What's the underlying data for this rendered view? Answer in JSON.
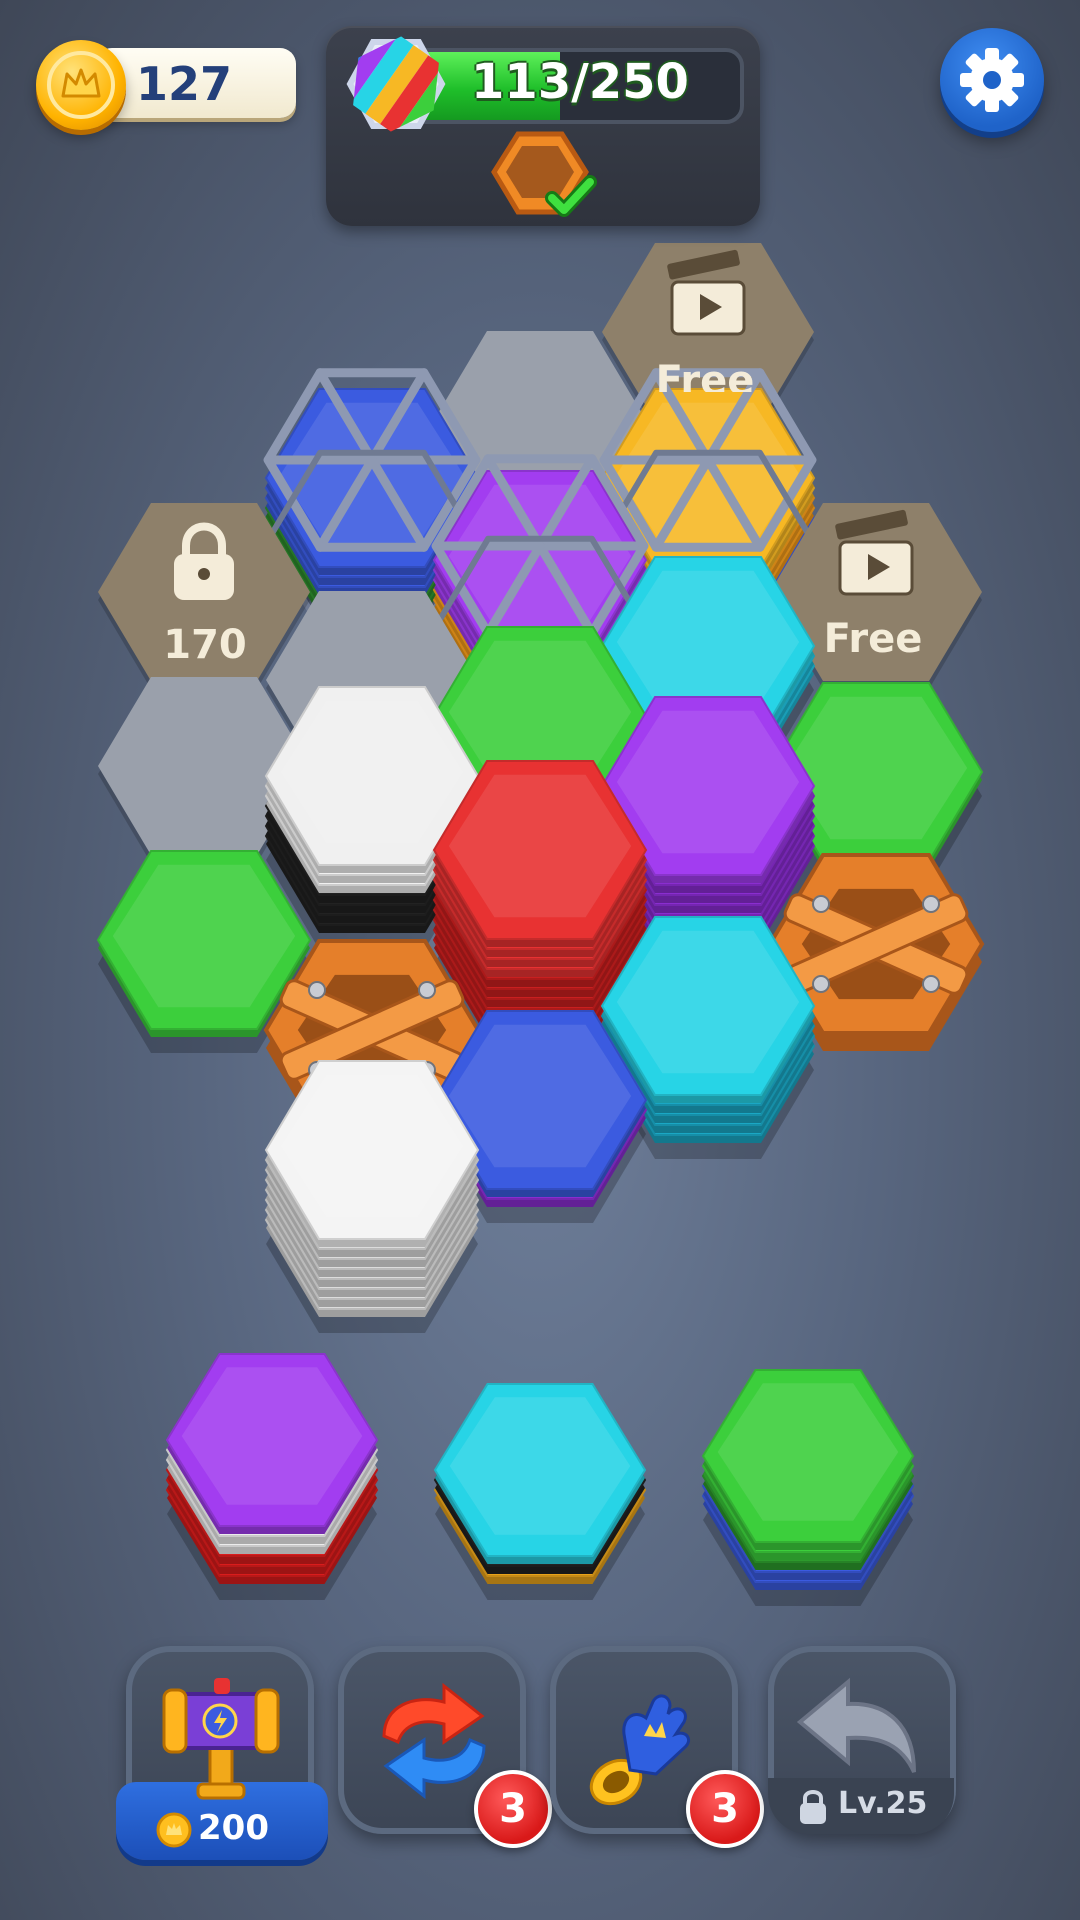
{
  "hud": {
    "coins": "127",
    "progress": {
      "text": "113/250",
      "current": 113,
      "total": 250
    },
    "next_reward_icon": "wooden-crate-hex-check-icon",
    "settings_icon": "gear-icon"
  },
  "locked_tiles": [
    {
      "type": "free-video",
      "label": "Free",
      "icon": "clapperboard-icon"
    },
    {
      "type": "free-video",
      "label": "Free",
      "icon": "clapperboard-icon"
    },
    {
      "type": "locked",
      "label": "170",
      "icon": "padlock-icon"
    }
  ],
  "board_stacks": [
    {
      "position": "top-left-caged",
      "layers": [
        "#2d8a2d",
        "#2d8a2d",
        "#3b5be0",
        "#3b5be0",
        "#3b5be0"
      ],
      "caged": true
    },
    {
      "position": "top-right-caged",
      "layers": [
        "#3b5be0",
        "#f29a1a",
        "#f29a1a",
        "#f7b824",
        "#f7b824"
      ],
      "caged": true
    },
    {
      "position": "center-caged",
      "layers": [
        "#f29a1a",
        "#f29a1a",
        "#a23df0",
        "#a23df0",
        "#a23df0"
      ],
      "caged": true
    },
    {
      "position": "cyan-upper",
      "layers": [
        "#1fb9d6",
        "#1fb9d6",
        "#27d4e6"
      ]
    },
    {
      "position": "green-center",
      "layers": [
        "#3ccf3c"
      ]
    },
    {
      "position": "green-right",
      "layers": [
        "#3ccf3c"
      ]
    },
    {
      "position": "white-black",
      "layers": [
        "#222",
        "#222",
        "#222",
        "#222",
        "#f0f0f0",
        "#f0f0f0",
        "#f0f0f0"
      ]
    },
    {
      "position": "red-tall",
      "layers": [
        "#c91f1f",
        "#c91f1f",
        "#c91f1f",
        "#c91f1f",
        "#c91f1f",
        "#c91f1f",
        "#e83232",
        "#e83232",
        "#e83232",
        "#e83232"
      ]
    },
    {
      "position": "purple-tall",
      "layers": [
        "#8a2dd0",
        "#8a2dd0",
        "#8a2dd0",
        "#8a2dd0",
        "#8a2dd0",
        "#8a2dd0",
        "#a23df0"
      ]
    },
    {
      "position": "green-left",
      "layers": [
        "#3ccf3c"
      ]
    },
    {
      "position": "cyan-lower",
      "layers": [
        "#1aa7c4",
        "#1aa7c4",
        "#1aa7c4",
        "#1aa7c4",
        "#27d4e6"
      ]
    },
    {
      "position": "blue-low",
      "layers": [
        "#8a2dd0",
        "#3b5be0"
      ]
    },
    {
      "position": "white-tall",
      "layers": [
        "#dcdcdc",
        "#dcdcdc",
        "#dcdcdc",
        "#dcdcdc",
        "#dcdcdc",
        "#dcdcdc",
        "#dcdcdc",
        "#f4f4f4"
      ]
    }
  ],
  "wooden_crates": 2,
  "tray_stacks": [
    {
      "layers": [
        "#d91c1c",
        "#d91c1c",
        "#d91c1c",
        "#ececec",
        "#ececec",
        "#a23df0"
      ]
    },
    {
      "layers": [
        "#e8a21a",
        "#222",
        "#27d4e6"
      ]
    },
    {
      "layers": [
        "#3b5be0",
        "#3b5be0",
        "#2d9a2d",
        "#3ccf3c",
        "#3ccf3c"
      ]
    }
  ],
  "tools": [
    {
      "name": "hammer",
      "icon": "hammer-icon",
      "cost": "200",
      "cost_icon": "crown-coin-icon"
    },
    {
      "name": "shuffle",
      "icon": "shuffle-arrows-icon",
      "count": "3"
    },
    {
      "name": "glove",
      "icon": "glove-icon",
      "count": "3"
    },
    {
      "name": "undo",
      "icon": "undo-arrow-icon",
      "lock_label": "Lv.25",
      "locked": true
    }
  ],
  "colors": {
    "background": "#5a6880",
    "accent_blue": "#1f63c9",
    "progress_green": "#1fbf2a",
    "badge_red": "#d91919",
    "empty_slot": "#9aa0ab",
    "locked_slot": "#8e806a"
  }
}
